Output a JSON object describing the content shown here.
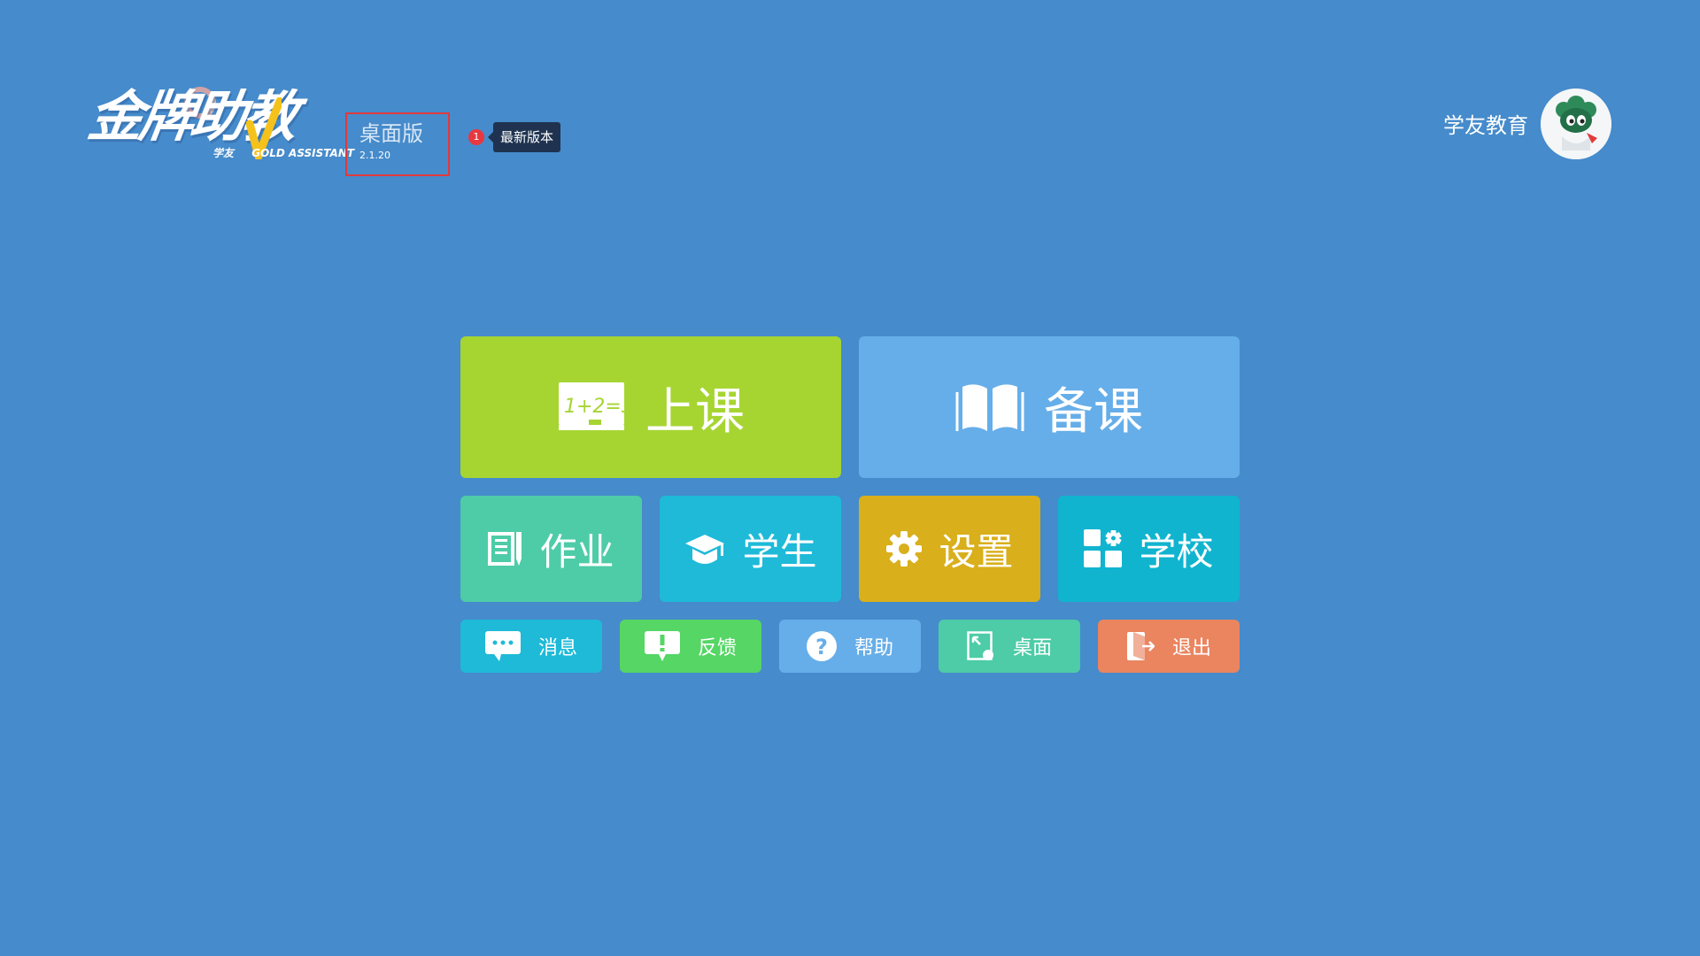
{
  "header": {
    "logo": {
      "main_text": "金牌助教",
      "sub_cn": "学友",
      "sub_en": "GOLD ASSISTANT"
    },
    "edition": {
      "name": "桌面版",
      "version": "2.1.20"
    },
    "update": {
      "badge": "1",
      "tooltip": "最新版本"
    },
    "user": {
      "name": "学友教育",
      "avatar_icon": "mascot-avatar-icon"
    }
  },
  "tiles": {
    "primary": [
      {
        "key": "class",
        "label": "上课",
        "icon": "chalkboard-icon",
        "color": "#a6d532"
      },
      {
        "key": "prepare",
        "label": "备课",
        "icon": "open-book-icon",
        "color": "#66aee9"
      }
    ],
    "secondary": [
      {
        "key": "homework",
        "label": "作业",
        "icon": "notebook-icon",
        "color": "#4dcca7"
      },
      {
        "key": "student",
        "label": "学生",
        "icon": "graduation-cap-icon",
        "color": "#1ebad8"
      },
      {
        "key": "settings",
        "label": "设置",
        "icon": "gear-icon",
        "color": "#d9af1b"
      },
      {
        "key": "school",
        "label": "学校",
        "icon": "apps-grid-icon",
        "color": "#10b4cf"
      }
    ],
    "tertiary": [
      {
        "key": "messages",
        "label": "消息",
        "icon": "chat-bubble-icon",
        "color": "#1ebad8"
      },
      {
        "key": "feedback",
        "label": "反馈",
        "icon": "exclamation-icon",
        "color": "#55d665"
      },
      {
        "key": "help",
        "label": "帮助",
        "icon": "question-icon",
        "color": "#66aee9"
      },
      {
        "key": "desktop",
        "label": "桌面",
        "icon": "desktop-icon",
        "color": "#4dcca7"
      },
      {
        "key": "exit",
        "label": "退出",
        "icon": "exit-door-icon",
        "color": "#ea8560"
      }
    ]
  },
  "colors": {
    "background": "#468bcb",
    "highlight_border": "#e0393e",
    "badge": "#e8383f",
    "tooltip_bg": "#1f3350"
  }
}
